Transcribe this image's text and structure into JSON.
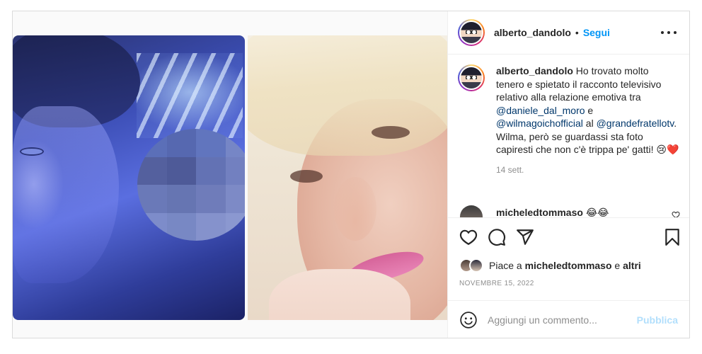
{
  "post": {
    "username": "alberto_dandolo",
    "separator": "•",
    "follow_label": "Segui"
  },
  "caption": {
    "username": "alberto_dandolo",
    "text_1": " Ho trovato molto tenero e spietato il racconto televisivo relativo alla relazione emotiva tra ",
    "mention_1": "@daniele_dal_moro",
    "text_2": " e ",
    "mention_2": "@wilmagoichofficial",
    "text_3": " al ",
    "mention_3": "@grandefratellotv",
    "text_4": ". Wilma, però se guardassi sta foto capiresti che non c'è trippa pe' gatti! 😢",
    "heart": "❤️",
    "time": "14 sett."
  },
  "comment_2": {
    "username": "micheledtommaso",
    "text": " 😂😂"
  },
  "likes": {
    "prefix": "Piace a ",
    "user": "micheledtommaso",
    "middle": " e ",
    "others": "altri"
  },
  "date": "NOVEMBRE 15, 2022",
  "add_comment": {
    "placeholder": "Aggiungi un commento...",
    "publish_label": "Pubblica"
  },
  "icons": {
    "like": "heart-icon",
    "comment": "comment-icon",
    "share": "paper-plane-icon",
    "save": "bookmark-icon",
    "emoji": "smiley-icon",
    "more": "more-options-icon"
  },
  "colors": {
    "link_blue": "#0095f6",
    "mention_blue": "#00376b",
    "muted": "#8e8e8e",
    "publish_disabled": "#b2dffc"
  }
}
